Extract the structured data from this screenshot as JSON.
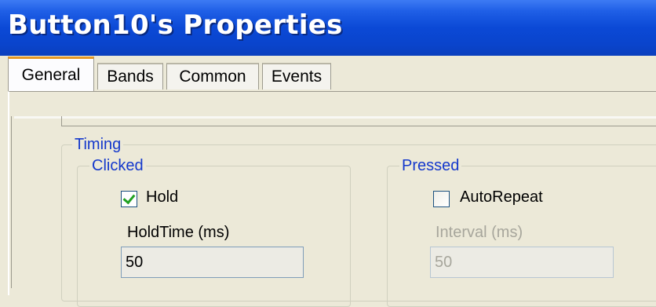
{
  "window": {
    "title": "Button10's Properties"
  },
  "tabs": [
    {
      "label": "General",
      "active": true
    },
    {
      "label": "Bands",
      "active": false
    },
    {
      "label": "Common",
      "active": false
    },
    {
      "label": "Events",
      "active": false
    }
  ],
  "timing": {
    "label": "Timing",
    "clicked": {
      "label": "Clicked",
      "hold": {
        "label": "Hold",
        "checked": true
      },
      "hold_time": {
        "label": "HoldTime (ms)",
        "value": "50",
        "enabled": true
      }
    },
    "pressed": {
      "label": "Pressed",
      "auto_repeat": {
        "label": "AutoRepeat",
        "checked": false
      },
      "interval": {
        "label": "Interval (ms)",
        "value": "50",
        "enabled": false
      }
    }
  },
  "colors": {
    "title_bar": "#0b49d6",
    "group_label": "#1438cc",
    "active_tab_accent": "#e69926",
    "checkmark": "#21a121",
    "disabled_text": "#a7a69c"
  }
}
